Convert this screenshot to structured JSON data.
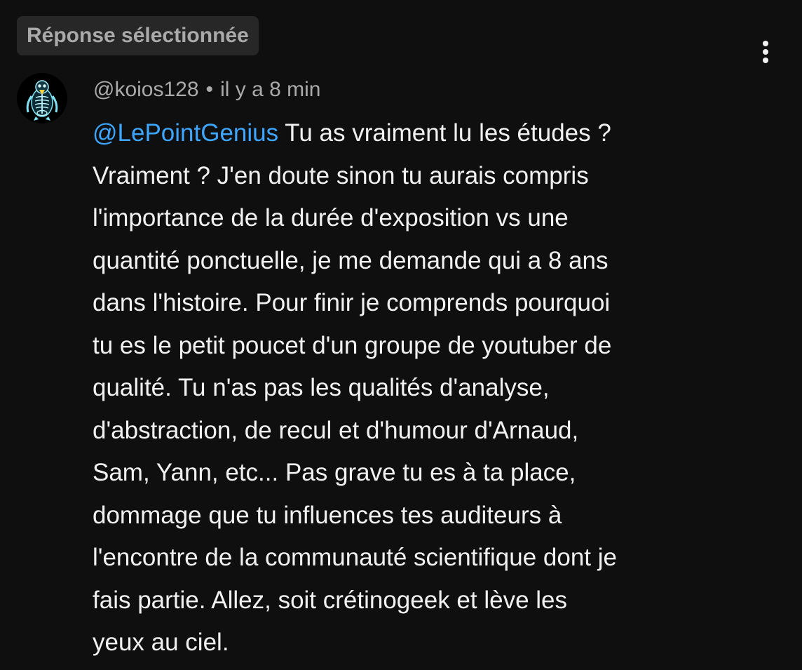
{
  "badge": {
    "label": "Réponse sélectionnée"
  },
  "comment": {
    "author": "@koios128",
    "separator": "•",
    "timestamp": "il y a 8 min",
    "mention": "@LePointGenius",
    "lines": [
      " Tu as vraiment lu les études ?",
      "Vraiment ? J'en doute sinon tu aurais compris",
      "l'importance de la durée d'exposition vs une",
      "quantité ponctuelle, je me demande qui a 8 ans",
      "dans l'histoire. Pour finir je comprends pourquoi",
      "tu es le petit poucet d'un groupe de youtuber de",
      "qualité. Tu n'as pas les qualités d'analyse,",
      "d'abstraction, de recul et d'humour d'Arnaud,",
      "Sam, Yann, etc... Pas grave tu es à ta place,",
      "dommage que tu influences tes auditeurs à",
      "l'encontre de la communauté scientifique dont je",
      "fais partie. Allez, soit crétinogeek et lève les",
      "yeux au ciel."
    ]
  },
  "icons": {
    "menu": "more-vert-icon",
    "avatar": "penguin-xray-avatar"
  },
  "colors": {
    "background": "#0f0f0f",
    "badge_bg": "#272727",
    "secondary_text": "#aaaaaa",
    "primary_text": "#f1f1f1",
    "mention": "#3ea6ff"
  }
}
